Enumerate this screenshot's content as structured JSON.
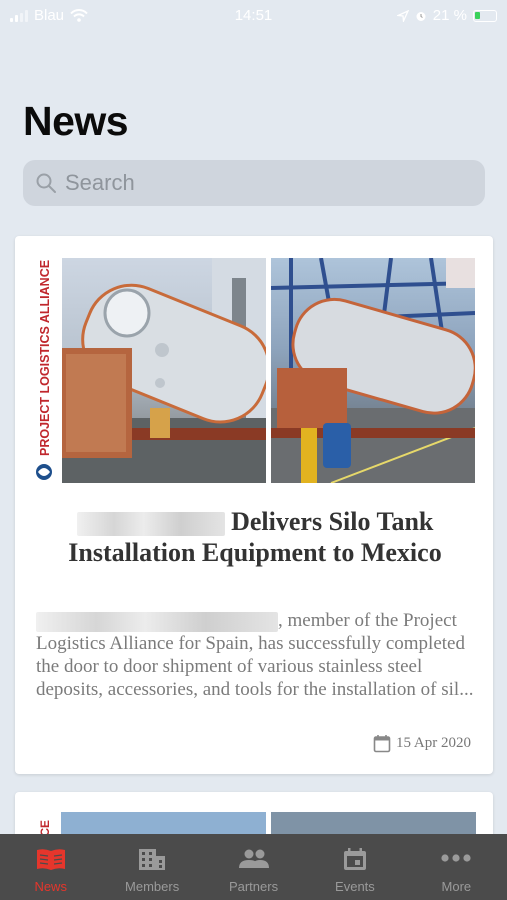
{
  "status_bar": {
    "carrier": "Blau",
    "time": "14:51",
    "battery": "21 %"
  },
  "page_title": "News",
  "search": {
    "placeholder": "Search"
  },
  "articles": [
    {
      "brand": "PROJECT LOGISTICS ALLIANCE",
      "title_rest": "Delivers Silo Tank Installation Equipment to Mexico",
      "excerpt_rest": ", member of the Project Logistics Alliance for Spain, has successfully completed the door to door shipment of various stainless steel deposits, accessories, and tools for the installation of sil...",
      "date": "15 Apr 2020"
    },
    {
      "brand": "ICE"
    }
  ],
  "tabs": [
    {
      "label": "News",
      "icon": "newspaper-icon",
      "active": true
    },
    {
      "label": "Members",
      "icon": "building-icon",
      "active": false
    },
    {
      "label": "Partners",
      "icon": "people-icon",
      "active": false
    },
    {
      "label": "Events",
      "icon": "calendar-icon",
      "active": false
    },
    {
      "label": "More",
      "icon": "more-icon",
      "active": false
    }
  ],
  "colors": {
    "accent": "#e5362c",
    "tab_bar": "#4b4b4b",
    "background": "#e3e9f0",
    "brand_red": "#c0272d"
  }
}
